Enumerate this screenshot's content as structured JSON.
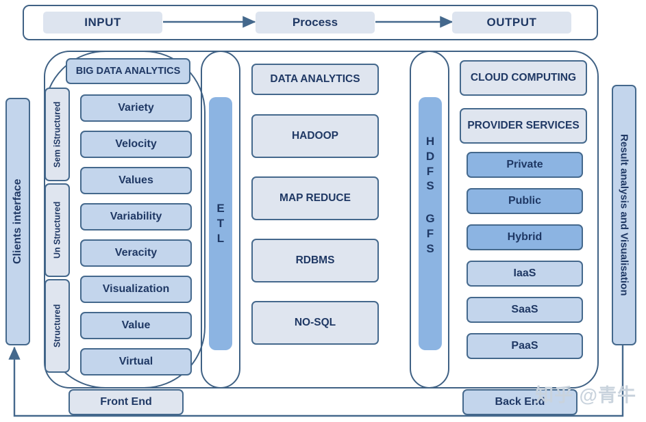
{
  "diagram": {
    "title_flow": {
      "steps": [
        {
          "label": "INPUT"
        },
        {
          "label": "Process"
        },
        {
          "label": "OUTPUT"
        }
      ]
    },
    "left_rail": {
      "label": "Clients interface"
    },
    "right_rail": {
      "label": "Result analysis and Visualisation"
    },
    "big_data": {
      "header": "BIG DATA ANALYTICS",
      "categories": [
        {
          "label": "Sem iStructured"
        },
        {
          "label": "Un Structured"
        },
        {
          "label": "Structured"
        }
      ],
      "items": [
        {
          "label": "Variety"
        },
        {
          "label": "Velocity"
        },
        {
          "label": "Values"
        },
        {
          "label": "Variability"
        },
        {
          "label": "Veracity"
        },
        {
          "label": "Visualization"
        },
        {
          "label": "Value"
        },
        {
          "label": "Virtual"
        }
      ]
    },
    "etl": {
      "letters": [
        "E",
        "T",
        "L"
      ]
    },
    "data_analytics": {
      "header": "DATA ANALYTICS",
      "items": [
        {
          "label": "HADOOP"
        },
        {
          "label": "MAP  REDUCE"
        },
        {
          "label": "RDBMS"
        },
        {
          "label": "NO-SQL"
        }
      ]
    },
    "storage": {
      "letters_top": [
        "H",
        "D",
        "F",
        "S"
      ],
      "letters_bottom": [
        "G",
        "F",
        "S"
      ]
    },
    "cloud": {
      "header": "CLOUD COMPUTING",
      "subheader": "PROVIDER SERVICES",
      "deployment_models": [
        {
          "label": "Private"
        },
        {
          "label": "Public"
        },
        {
          "label": "Hybrid"
        }
      ],
      "service_models": [
        {
          "label": "IaaS"
        },
        {
          "label": "SaaS"
        },
        {
          "label": "PaaS"
        }
      ]
    },
    "ends": {
      "front": "Front End",
      "back": "Back End"
    },
    "watermark": "知乎 @青牛",
    "colors": {
      "border": "#44688c",
      "text": "#1f3864",
      "fill_pale": "#dfe5ef",
      "fill_light": "#c3d5ec",
      "fill_medium": "#8cb4e2",
      "frame": "#3f6184"
    }
  }
}
